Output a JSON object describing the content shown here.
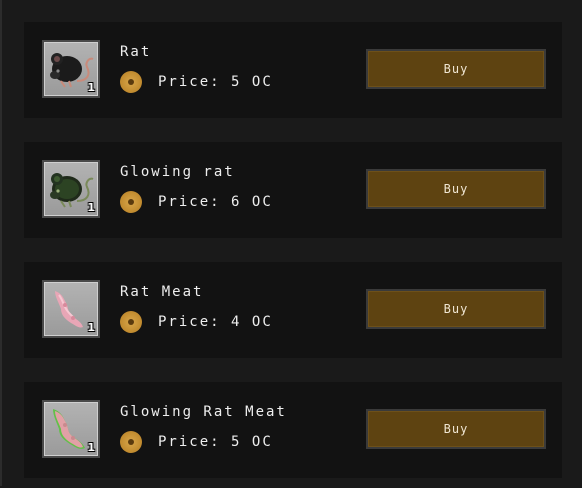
{
  "shop": {
    "items": [
      {
        "name": "Rat",
        "price_label": "Price:",
        "price_value": "5",
        "currency": "OC",
        "quantity": "1",
        "buy_label": "Buy",
        "icon": "rat-icon"
      },
      {
        "name": "Glowing rat",
        "price_label": "Price:",
        "price_value": "6",
        "currency": "OC",
        "quantity": "1",
        "buy_label": "Buy",
        "icon": "glowing-rat-icon"
      },
      {
        "name": "Rat Meat",
        "price_label": "Price:",
        "price_value": "4",
        "currency": "OC",
        "quantity": "1",
        "buy_label": "Buy",
        "icon": "rat-meat-icon"
      },
      {
        "name": "Glowing Rat Meat",
        "price_label": "Price:",
        "price_value": "5",
        "currency": "OC",
        "quantity": "1",
        "buy_label": "Buy",
        "icon": "glowing-rat-meat-icon"
      }
    ]
  },
  "colors": {
    "background": "#1a1a1a",
    "row": "#121212",
    "button": "#5e4311",
    "coin": "#c08a2e"
  }
}
